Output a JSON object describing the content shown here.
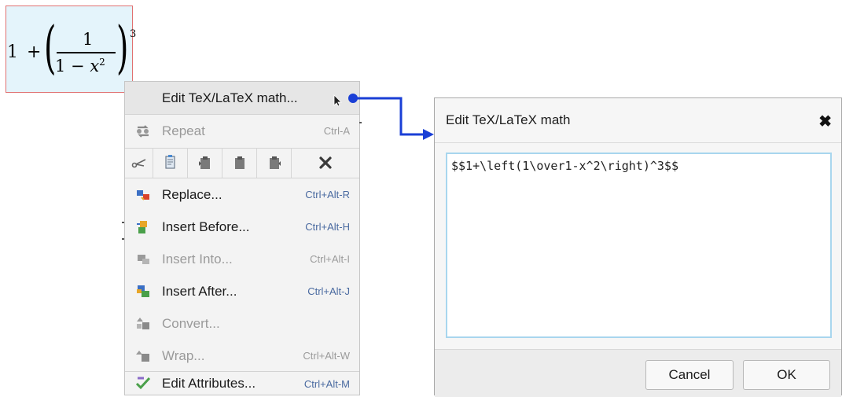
{
  "math": {
    "one": "1",
    "plus": "+",
    "lparen": "(",
    "rparen": ")",
    "numerator": "1",
    "den_one": "1",
    "den_minus": " − ",
    "den_var": "x",
    "den_exp": "2",
    "exponent": "3"
  },
  "menu": {
    "edit_tex": {
      "label": "Edit TeX/LaTeX math..."
    },
    "repeat": {
      "label": "Repeat",
      "shortcut": "Ctrl-A"
    },
    "replace": {
      "label": "Replace...",
      "shortcut": "Ctrl+Alt-R"
    },
    "insert_before": {
      "label": "Insert Before...",
      "shortcut": "Ctrl+Alt-H"
    },
    "insert_into": {
      "label": "Insert Into...",
      "shortcut": "Ctrl+Alt-I"
    },
    "insert_after": {
      "label": "Insert After...",
      "shortcut": "Ctrl+Alt-J"
    },
    "convert": {
      "label": "Convert..."
    },
    "wrap": {
      "label": "Wrap...",
      "shortcut": "Ctrl+Alt-W"
    },
    "edit_attributes": {
      "label": "Edit Attributes...",
      "shortcut": "Ctrl+Alt-M"
    },
    "toolbar_icons": [
      "cut-icon",
      "copy-icon",
      "paste-before-icon",
      "paste-icon",
      "paste-after-icon",
      "delete-icon"
    ]
  },
  "dialog": {
    "title": "Edit TeX/LaTeX math",
    "editor_value": "$$1+\\left(1\\over1-x^2\\right)^3$$",
    "cancel_label": "Cancel",
    "ok_label": "OK"
  },
  "colors": {
    "connector": "#1a3fd6",
    "math_bg": "#e4f4fb",
    "math_border": "#e07070",
    "editor_border": "#a8d6ee",
    "shortcut": "#4a6aa0"
  }
}
